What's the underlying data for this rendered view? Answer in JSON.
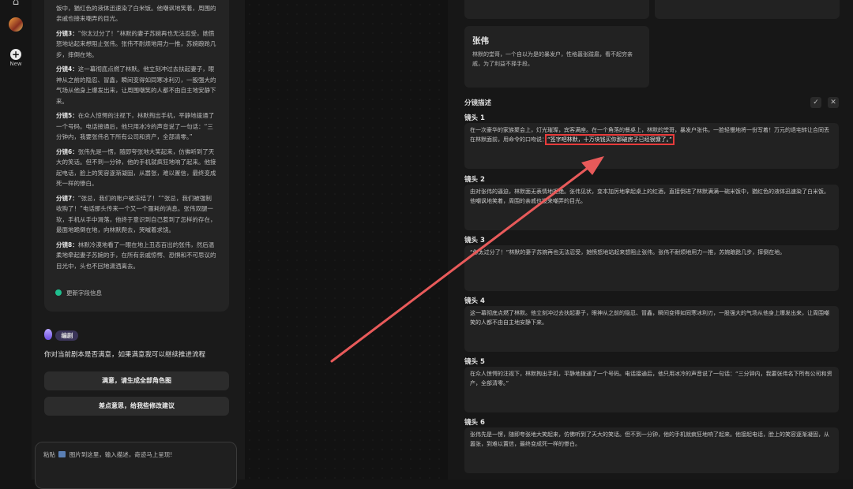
{
  "rail": {
    "home_icon": "home-icon",
    "avatar_icon": "avatar-icon",
    "new_label": "New"
  },
  "chat": {
    "scenes": [
      {
        "label": "",
        "text": "状，变本加厉地拿起桌上的红酒，直接倒进了林默满满一碗米饭中，猶红色的液体迅速染了白米饭。他嘲讽地笑着，周围的亲戚也接来嘲弄的目光。"
      },
      {
        "label": "分镜3：",
        "text": "“你太过分了！”林默的妻子苏婉再也无法忍受，她愤怒地站起来想阻止张伟。张伟不耐烦地用力一推，苏婉踉跄几步，摔倒在地。"
      },
      {
        "label": "分镜4：",
        "text": "这一幕彻底点燃了林默。他立刻冲过去扶起妻子，眼神从之前的隐忍、冒鑫，瞬间变得如同寒冰利刃，一股强大的气场从他身上爆发出来，让周围嘲笑的人都不由自主地安静下来。"
      },
      {
        "label": "分镜5：",
        "text": "在众人惊愕的注视下，林默掏出手机，平静地拨通了一个号码。电话接通后，他只用冰冷的声音说了一句话：“三分钟内，我要张伟名下所有公司和资产，全部清零。”"
      },
      {
        "label": "分镜6：",
        "text": "张伟先是一愣，随即夸张地大笑起来，仿佛听到了天大的笑话。但不到一分钟，他的手机就疯狂地响了起来。他接起电话，脸上的笑容逐渐凝固，从嚣张，难以置信，最终变成死一样的惨白。"
      },
      {
        "label": "分镜7：",
        "text": "“张总，我们的账户被冻结了！”“张总，我们被强制收购了！”电话那头传来一个又一个噩耗的消息。张伟双腿一软，手机从手中滑落，他终于意识到自己惹到了怎样的存在，最面地跪倒在地，向林默爬去，哭喊着求饶。"
      },
      {
        "label": "分镜8：",
        "text": "林默冷漠地看了一眼在地上丑态百出的张伟，然后温柔地牵起妻子苏婉的手，在所有亲戚惊愕、恐惧和不可思议的目光中，头也不回地潇洒离去。"
      }
    ],
    "update_label": "更新字段信息",
    "writer_label": "编剧",
    "question": "你对当前剧本是否满意，如果满意我可以继续推进流程",
    "btn_satisfied": "满意，请生成全部角色图",
    "btn_suggest": "差点意思，给我些修改建议",
    "composer_prefix": "粘贴",
    "composer_placeholder": "图片到这里，输入描述，奇迹马上呈现!"
  },
  "right": {
    "character": {
      "name": "张伟",
      "desc": "林默的堂哥，一个自以为是的暴发户，性格嚣张跋扈，看不起穷亲戚，为了利益不择手段。"
    },
    "section_title": "分镜描述",
    "confirm_icon": "check-icon",
    "close_icon": "close-icon",
    "shots": [
      {
        "label": "镜头 1",
        "text": "在一次豪华的家族聚会上，灯光璀璨，宾客满座。在一个角落的餐桌上，林默的堂哥，暴发户张伟，一脸轻慢地将一份写着！万元的退宅转让合同丢在林默面前，用命令的口吻说：",
        "highlight": "“签字吧林默，十万块钱买你那破房子已经很慷了。”"
      },
      {
        "label": "镜头 2",
        "text": "由对张伟的逼迫，林默面无表情地拒绝。张伟见状，变本加厉地拿起桌上的红酒，直接倒进了林默满满一碗米饭中，猶红色的液体迅速染了白米饭。他嘲讽地笑着，周围的亲戚也投来嘲弄的目光。",
        "highlight": ""
      },
      {
        "label": "镜头 3",
        "text": "“你太过分了！”林默的妻子苏婉再也无法忍受，她愤怒地站起来想阻止张伟。张伟不耐烦地用力一推，苏婉踉跄几步，摔倒在地。",
        "highlight": ""
      },
      {
        "label": "镜头 4",
        "text": "这一幕彻底点燃了林默。他立刻冲过去扶起妻子，眼神从之前的隐忍、冒鑫，瞬间变得如同寒冰利刃，一股强大的气场从他身上爆发出来，让周围嘲笑的人都不由自主地安静下来。",
        "highlight": ""
      },
      {
        "label": "镜头 5",
        "text": "在众人惊愕的注视下，林默掏出手机，平静地拨通了一个号码。电话接通后，他只用冰冷的声音说了一句话：“三分钟内，我要张伟名下所有公司和资产，全部清零。”",
        "highlight": ""
      },
      {
        "label": "镜头 6",
        "text": "张伟先是一愣，随即夸张地大笑起来，仿佛听到了天大的笑话。但不到一分钟，他的手机就疯狂地响了起来。他接起电话，脸上的笑容逐渐凝固，从嚣张，到难以置信，最终变成死一样的惨白。",
        "highlight": ""
      }
    ]
  },
  "colors": {
    "highlight_border": "#e83b3b",
    "arrow": "#e85a5a",
    "status_dot": "#1fbf8f"
  }
}
